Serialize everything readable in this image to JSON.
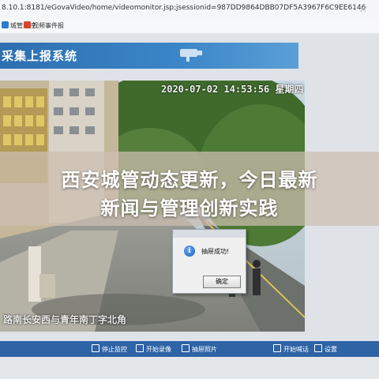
{
  "browser": {
    "url": "8.10.1:8181/eGovaVideo/home/videomonitor.jsp;jsessionid=987DD9864DBB07DF5A3967F6C9EE6146",
    "bookmarks": [
      "城管监控",
      "视频事件报"
    ]
  },
  "app": {
    "banner_title": "采集上报系统"
  },
  "video": {
    "timestamp": "2020-07-02 14:53:56 星期四",
    "street_label": "路南长安西与青年南丁字北角"
  },
  "headline": {
    "line1": "西安城管动态更新，今日最新",
    "line2": "新闻与管理创新实践"
  },
  "dialog": {
    "message": "抽屉成功!",
    "ok_label": "确定"
  },
  "toolbar": {
    "items": [
      "停止监控",
      "开始录像",
      "抽屉照片",
      "开始喊话",
      "设置"
    ]
  },
  "colors": {
    "banner": "#3b86c8",
    "toolbar": "#2e63a6",
    "overlay": "#cdbeb2"
  }
}
